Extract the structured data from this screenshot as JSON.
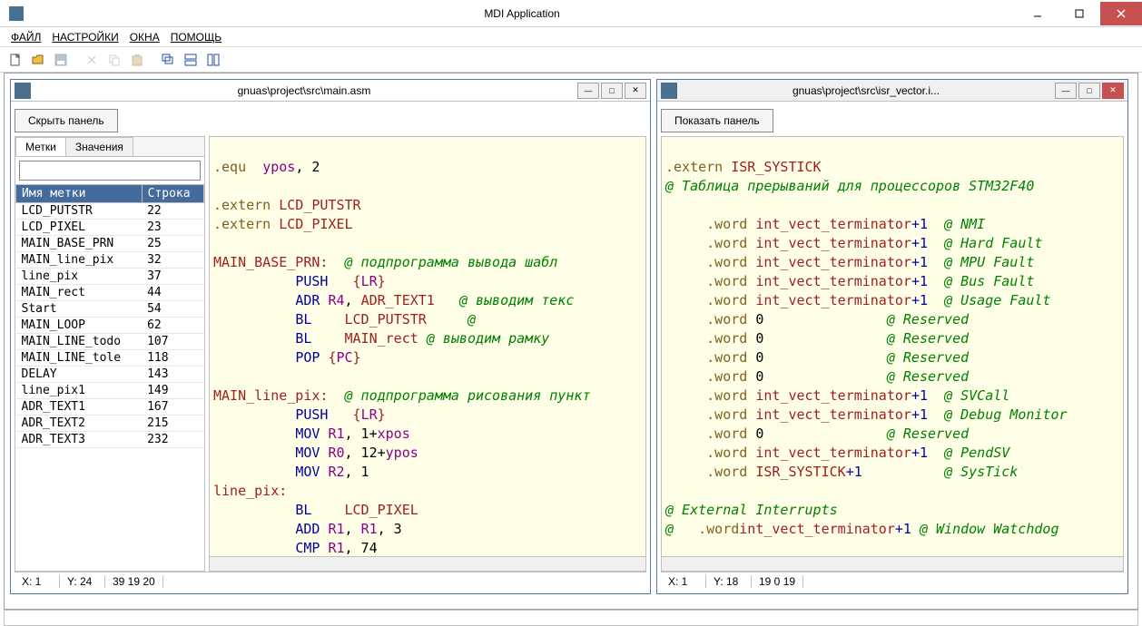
{
  "app": {
    "title": "MDI Application"
  },
  "menu": {
    "file": "ФАЙЛ",
    "settings": "НАСТРОЙКИ",
    "windows": "ОКНА",
    "help": "ПОМОЩЬ"
  },
  "window1": {
    "title": "gnuas\\project\\src\\main.asm",
    "panel_btn": "Скрыть панель",
    "tabs": {
      "labels": "Метки",
      "values": "Значения"
    },
    "table": {
      "col1": "Имя метки",
      "col2": "Строка",
      "rows": [
        {
          "n": "LCD_PUTSTR",
          "l": "22"
        },
        {
          "n": "LCD_PIXEL",
          "l": "23"
        },
        {
          "n": "MAIN_BASE_PRN",
          "l": "25"
        },
        {
          "n": "MAIN_line_pix",
          "l": "32"
        },
        {
          "n": "line_pix",
          "l": "37"
        },
        {
          "n": "MAIN_rect",
          "l": "44"
        },
        {
          "n": "Start",
          "l": "54"
        },
        {
          "n": "MAIN_LOOP",
          "l": "62"
        },
        {
          "n": "MAIN_LINE_todo",
          "l": "107"
        },
        {
          "n": "MAIN_LINE_tole",
          "l": "118"
        },
        {
          "n": "DELAY",
          "l": "143"
        },
        {
          "n": "line_pix1",
          "l": "149"
        },
        {
          "n": "ADR_TEXT1",
          "l": "167"
        },
        {
          "n": "ADR_TEXT2",
          "l": "215"
        },
        {
          "n": "ADR_TEXT3",
          "l": "232"
        }
      ]
    },
    "status": {
      "x": "X: 1",
      "y": "Y: 24",
      "sz": "39 19 20"
    }
  },
  "window2": {
    "title": "gnuas\\project\\src\\isr_vector.i...",
    "panel_btn": "Показать панель",
    "status": {
      "x": "X: 1",
      "y": "Y: 18",
      "sz": "19 0 19"
    }
  },
  "code1": {
    "l1_a": ".equ",
    "l1_b": "ypos",
    "l1_c": ", 2",
    "l2_a": ".extern",
    "l2_b": "LCD_PUTSTR",
    "l3_a": ".extern",
    "l3_b": "LCD_PIXEL",
    "l4_a": "MAIN_BASE_PRN:",
    "l4_b": "@ подпрограмма вывода шабл",
    "l5_a": "PUSH",
    "l5_b": "{",
    "l5_c": "LR",
    "l5_d": "}",
    "l6_a": "ADR",
    "l6_b": "R4",
    "l6_c": ", ",
    "l6_d": "ADR_TEXT1",
    "l6_e": "@ выводим текс",
    "l7_a": "BL",
    "l7_b": "LCD_PUTSTR",
    "l7_c": "@",
    "l8_a": "BL",
    "l8_b": "MAIN_rect",
    "l8_c": "@ выводим рамку",
    "l9_a": "POP",
    "l9_b": "{",
    "l9_c": "PC",
    "l9_d": "}",
    "l10_a": "MAIN_line_pix:",
    "l10_b": "@ подпрограмма рисования пункт",
    "l11_a": "PUSH",
    "l11_b": "{",
    "l11_c": "LR",
    "l11_d": "}",
    "l12_a": "MOV",
    "l12_b": "R1",
    "l12_c": ", 1+",
    "l12_d": "xpos",
    "l13_a": "MOV",
    "l13_b": "R0",
    "l13_c": ", 12+",
    "l13_d": "ypos",
    "l14_a": "MOV",
    "l14_b": "R2",
    "l14_c": ", 1",
    "l15_a": "line_pix:",
    "l16_a": "BL",
    "l16_b": "LCD_PIXEL",
    "l17_a": "ADD",
    "l17_b": "R1",
    "l17_c": ", ",
    "l17_d": "R1",
    "l17_e": ", 3",
    "l18_a": "CMP",
    "l18_b": "R1",
    "l18_c": ", 74"
  },
  "code2": {
    "l1_a": ".extern",
    "l1_b": "ISR_SYSTICK",
    "l2": "@ Таблица прерываний для процессоров STM32F40",
    "w": ".word",
    "t": "int_vect_terminator",
    "p": "+1",
    "c_nmi": "@ NMI",
    "c_hf": "@ Hard Fault",
    "c_mpu": "@ MPU Fault",
    "c_bus": "@ Bus Fault",
    "c_usage": "@ Usage Fault",
    "c_res": "@ Reserved",
    "c_svc": "@ SVCall",
    "c_dbg": "@ Debug Monitor",
    "c_pend": "@ PendSV",
    "c_sys": "@ SysTick",
    "zero": "0",
    "isr": "ISR_SYSTICK",
    "ext": "@ External Interrupts",
    "c_wd": "@ Window Watchdog"
  }
}
